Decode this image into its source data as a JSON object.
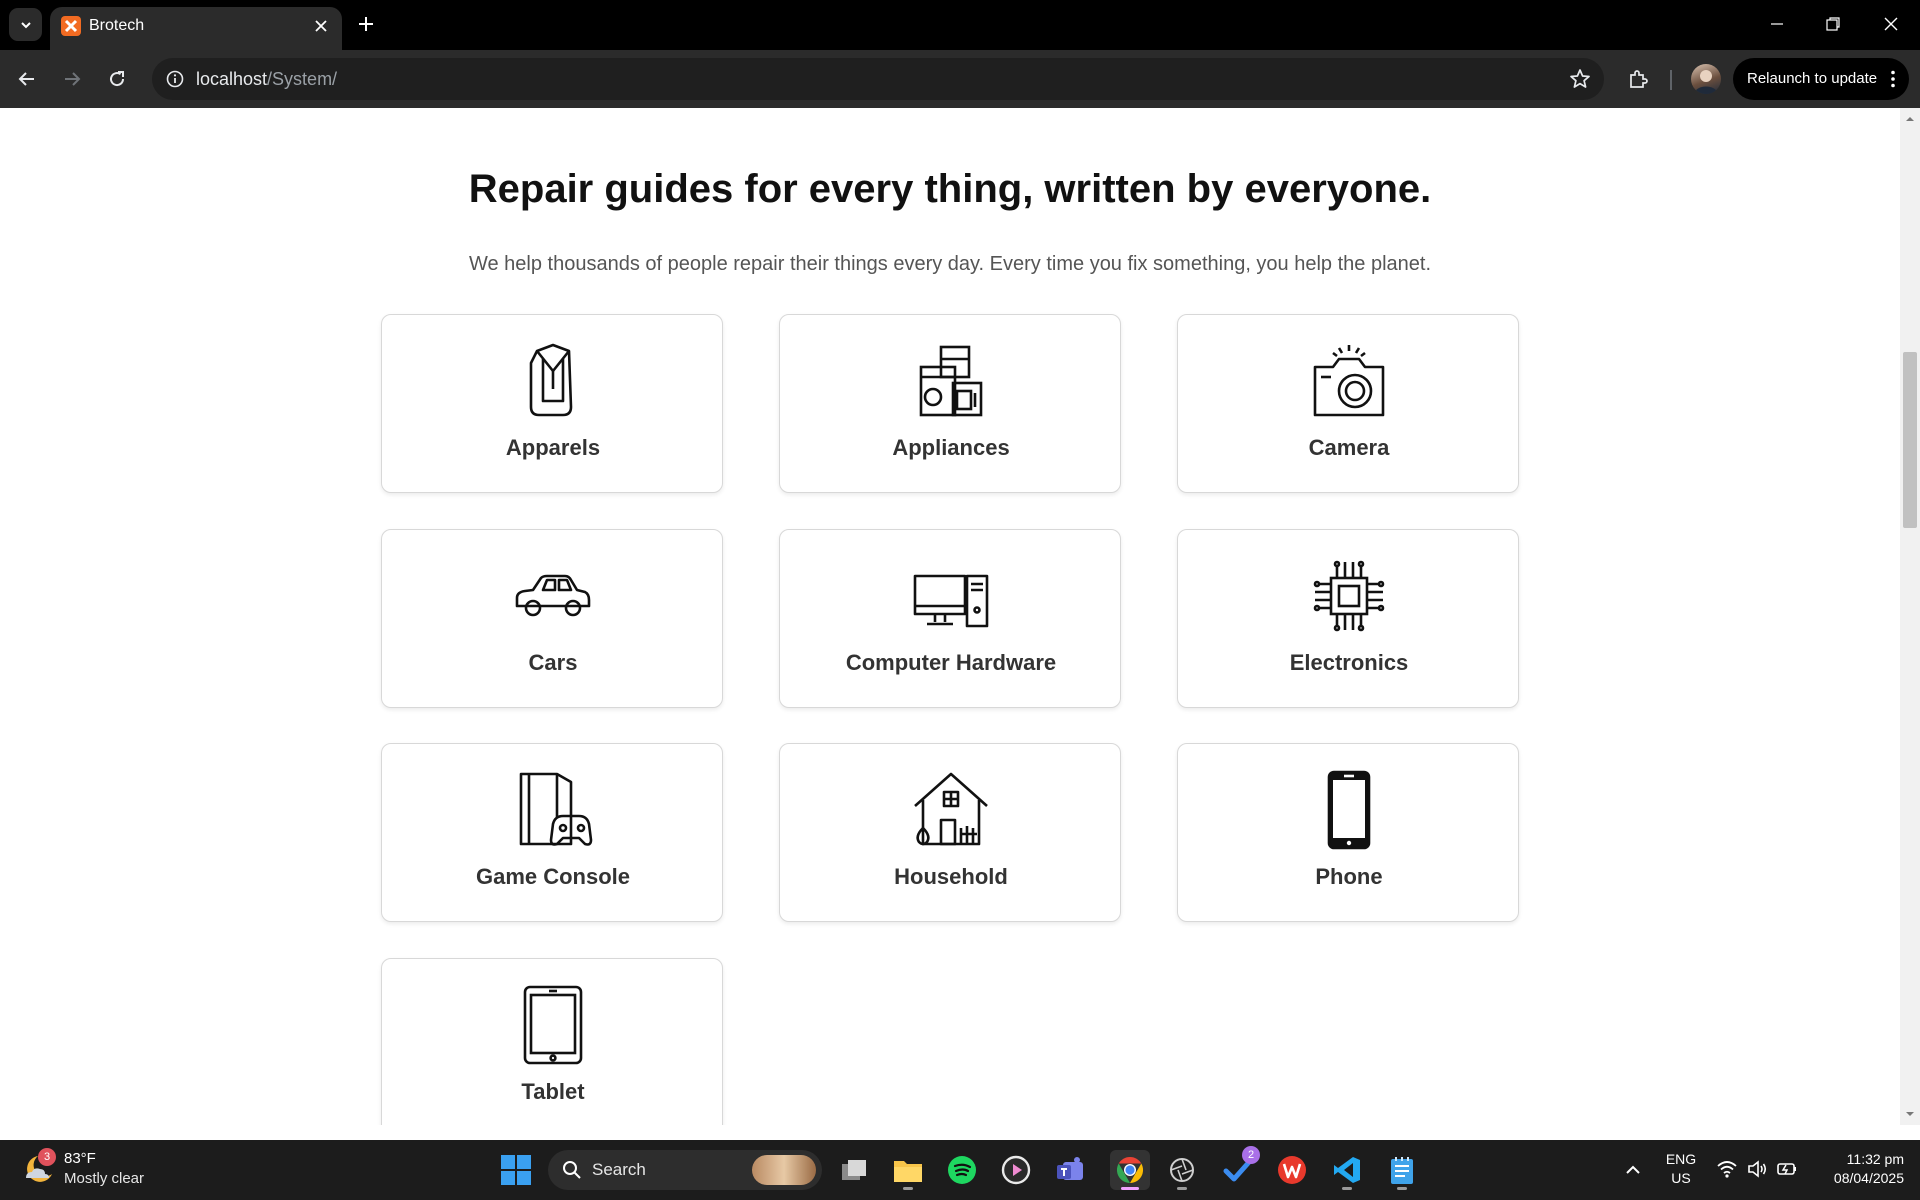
{
  "browser": {
    "tab_title": "Brotech",
    "url_host": "localhost",
    "url_path": "/System/",
    "relaunch_label": "Relaunch to update"
  },
  "page": {
    "title": "Repair guides for every thing, written by everyone.",
    "subtitle": "We help thousands of people repair their things every day. Every time you fix something, you help the planet."
  },
  "categories": [
    {
      "label": "Apparels",
      "icon": "shirt-icon"
    },
    {
      "label": "Appliances",
      "icon": "appliances-icon"
    },
    {
      "label": "Camera",
      "icon": "camera-icon"
    },
    {
      "label": "Cars",
      "icon": "car-icon"
    },
    {
      "label": "Computer Hardware",
      "icon": "desktop-computer-icon"
    },
    {
      "label": "Electronics",
      "icon": "chip-icon"
    },
    {
      "label": "Game Console",
      "icon": "game-console-icon"
    },
    {
      "label": "Household",
      "icon": "house-icon"
    },
    {
      "label": "Phone",
      "icon": "phone-icon"
    },
    {
      "label": "Tablet",
      "icon": "tablet-icon"
    }
  ],
  "taskbar": {
    "weather_temp": "83°F",
    "weather_desc": "Mostly clear",
    "weather_badge": "3",
    "search_label": "Search",
    "todo_badge": "2",
    "lang_1": "ENG",
    "lang_2": "US",
    "time": "11:32 pm",
    "date": "08/04/2025"
  },
  "colors": {
    "chrome_bg": "#000000",
    "toolbar_bg": "#2b2b2b",
    "card_border": "#d8d8d8",
    "taskbar_bg": "#1c1c1c"
  }
}
